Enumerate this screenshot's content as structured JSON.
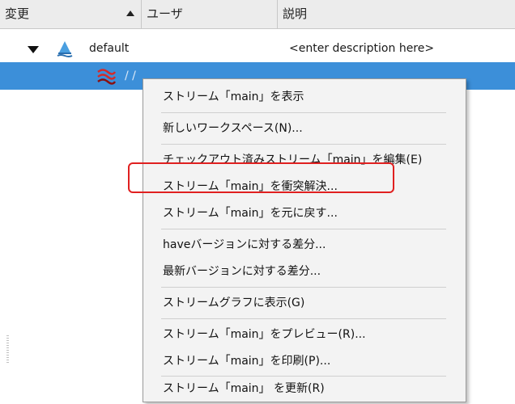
{
  "columns": {
    "change": "変更",
    "user": "ユーザ",
    "description": "説明"
  },
  "tree": {
    "default_row": {
      "name": "default",
      "description": "<enter description here>",
      "icon": "depot-icon"
    },
    "selected_row": {
      "partial_text": "/ /",
      "icon": "stream-icon"
    }
  },
  "context_menu": {
    "items": [
      "ストリーム「main」を表示",
      "新しいワークスペース(N)...",
      "チェックアウト済みストリーム「main」を編集(E)",
      "ストリーム「main」を衝突解決...",
      "ストリーム「main」を元に戻す...",
      "haveバージョンに対する差分...",
      "最新バージョンに対する差分...",
      "ストリームグラフに表示(G)",
      "ストリーム「main」をプレビュー(R)...",
      "ストリーム「main」を印刷(P)...",
      "ストリーム「main」 を更新(R)"
    ],
    "highlighted_item": "ストリーム「main」を衝突解決..."
  },
  "colors": {
    "selection": "#3c8fd9",
    "highlight_border": "#e02020",
    "menu_background": "#f3f3f3",
    "header_background": "#ececec"
  }
}
